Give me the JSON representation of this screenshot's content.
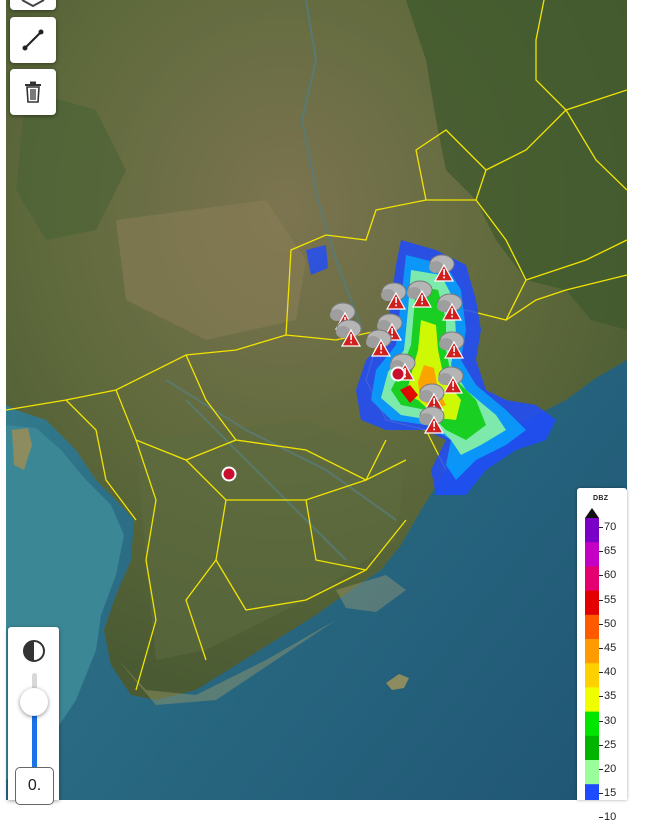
{
  "map": {
    "controls": [
      {
        "name": "layers",
        "icon": "layers-icon"
      },
      {
        "name": "measure",
        "icon": "ruler-line-icon"
      },
      {
        "name": "delete",
        "icon": "trash-icon"
      }
    ],
    "markers": {
      "warning_icon": "thunderstorm-warning-icon",
      "location_icon": "red-dot-marker-icon",
      "location_color": "#c8102e"
    }
  },
  "opacity": {
    "icon": "contrast-icon",
    "value": "0.",
    "level": 0.75
  },
  "legend": {
    "unit": "DBZ",
    "ticks": [
      "70",
      "65",
      "60",
      "55",
      "50",
      "45",
      "40",
      "35",
      "30",
      "25",
      "20",
      "15",
      "10"
    ],
    "colors": [
      "#7a00c8",
      "#c400c4",
      "#e4006e",
      "#e30000",
      "#ff5a00",
      "#ff9a00",
      "#ffd000",
      "#f0ff00",
      "#00e600",
      "#00b400",
      "#9aff9a",
      "#1e4bff",
      "#00a0ff"
    ]
  }
}
